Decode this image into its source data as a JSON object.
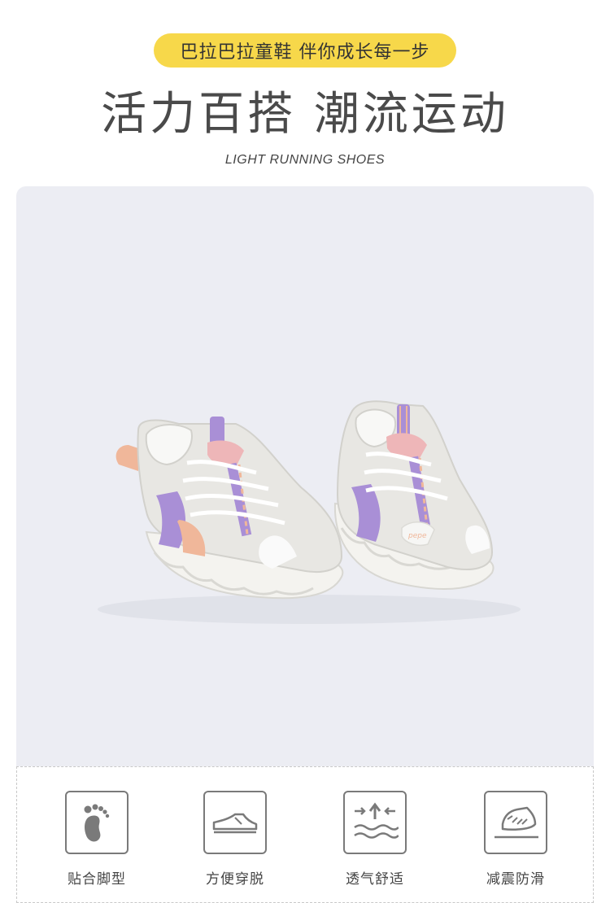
{
  "banner": {
    "pill_text": "巴拉巴拉童鞋 伴你成长每一步"
  },
  "heading": {
    "title": "活力百搭 潮流运动",
    "subtitle": "LIGHT RUNNING SHOES"
  },
  "product": {
    "logo_text": "pepe"
  },
  "features": [
    {
      "label": "贴合脚型",
      "icon": "foot-icon"
    },
    {
      "label": "方便穿脱",
      "icon": "shoe-icon"
    },
    {
      "label": "透气舒适",
      "icon": "airflow-icon"
    },
    {
      "label": "减震防滑",
      "icon": "sole-icon"
    }
  ],
  "colors": {
    "pill": "#f7d84a",
    "photo_bg": "#ecedf3",
    "accent_purple": "#a98fd6",
    "accent_peach": "#f0b79a",
    "accent_pink": "#eeb6b8"
  }
}
